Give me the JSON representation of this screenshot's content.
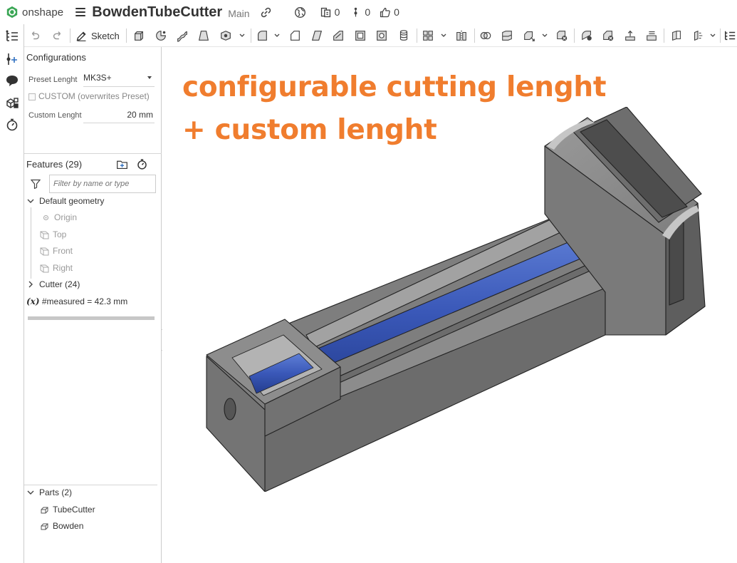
{
  "app": {
    "logo_text": "onshape"
  },
  "document": {
    "title": "BowdenTubeCutter",
    "workspace": "Main"
  },
  "header_counts": {
    "versions": "0",
    "branches": "0",
    "likes": "0"
  },
  "toolbar": {
    "sketch_label": "Sketch"
  },
  "configurations": {
    "title": "Configurations",
    "preset_label": "Preset Lenght",
    "preset_value": "MK3S+",
    "custom_checkbox_label": "CUSTOM (overwrites Preset)",
    "custom_length_label": "Custom Lenght",
    "custom_length_value": "20 mm"
  },
  "features": {
    "title": "Features (29)",
    "filter_placeholder": "Filter by name or type",
    "default_geometry": "Default geometry",
    "items": [
      "Origin",
      "Top",
      "Front",
      "Right"
    ],
    "cutter_folder": "Cutter (24)",
    "variable_symbol": "(x)",
    "variable_text": "#measured = 42.3 mm"
  },
  "parts": {
    "title": "Parts (2)",
    "items": [
      "TubeCutter",
      "Bowden"
    ]
  },
  "annotation": {
    "line1": "configurable cutting lenght",
    "line2": "+ custom lenght"
  },
  "colors": {
    "accent_orange": "#f07d2e",
    "tube_blue": "#3b5bb5",
    "model_gray": "#8b8b8b",
    "logo_green": "#3aa655"
  }
}
